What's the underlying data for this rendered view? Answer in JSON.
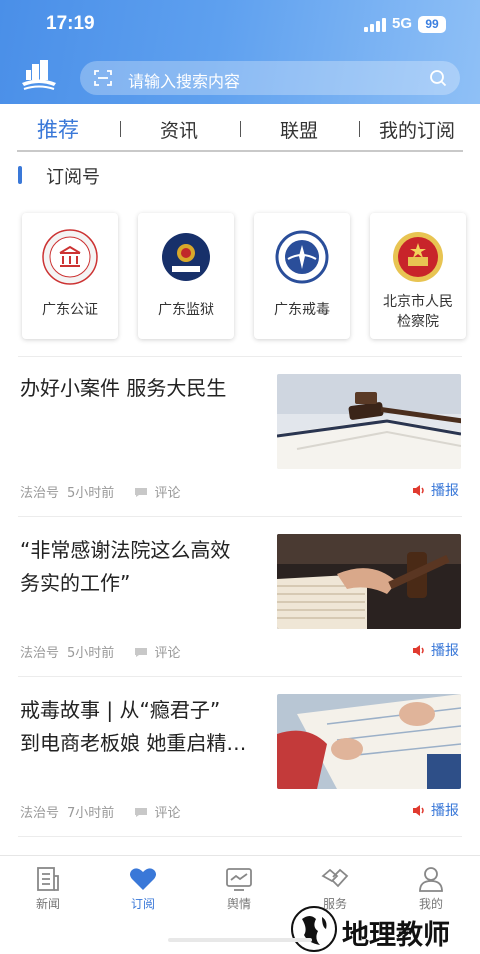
{
  "status": {
    "time": "17:19",
    "network": "5G",
    "battery": "99"
  },
  "search": {
    "placeholder": "请输入搜索内容"
  },
  "tabs": [
    {
      "label": "推荐",
      "active": true
    },
    {
      "label": "资讯",
      "active": false
    },
    {
      "label": "联盟",
      "active": false
    },
    {
      "label": "我的订阅",
      "active": false
    }
  ],
  "section": {
    "title": "订阅号"
  },
  "subscriptions": [
    {
      "name": "广东公证",
      "icon": "notary-emblem-icon"
    },
    {
      "name": "广东监狱",
      "icon": "police-emblem-icon"
    },
    {
      "name": "广东戒毒",
      "icon": "drug-rehab-emblem-icon"
    },
    {
      "name_line1": "北京市人民",
      "name_line2": "检察院",
      "icon": "national-emblem-icon"
    }
  ],
  "news": [
    {
      "title": "办好小案件 服务大民生",
      "source": "法治号",
      "time": "5小时前",
      "comment": "评论",
      "play": "播报",
      "thumb": "gavel-on-book-photo"
    },
    {
      "title_line1": "“非常感谢法院这么高效",
      "title_line2": "务实的工作”",
      "source": "法治号",
      "time": "5小时前",
      "comment": "评论",
      "play": "播报",
      "thumb": "gavel-on-papers-photo"
    },
    {
      "title_line1": "戒毒故事 | 从“瘾君子”",
      "title_line2": "到电商老板娘 她重启精…",
      "source": "法治号",
      "time": "7小时前",
      "comment": "评论",
      "play": "播报",
      "thumb": "hands-writing-photo"
    }
  ],
  "bottom_nav": [
    {
      "label": "新闻",
      "icon": "newspaper-icon",
      "active": false
    },
    {
      "label": "订阅",
      "icon": "heart-icon",
      "active": true
    },
    {
      "label": "舆情",
      "icon": "monitor-chart-icon",
      "active": false
    },
    {
      "label": "服务",
      "icon": "handshake-icon",
      "active": false
    },
    {
      "label": "我的",
      "icon": "user-icon",
      "active": false
    }
  ],
  "watermark": {
    "text": "地理教师"
  },
  "colors": {
    "accent": "#3a78d8",
    "header_start": "#4a8fe8",
    "header_end": "#8fc0f6",
    "play_icon": "#e03a2f"
  }
}
